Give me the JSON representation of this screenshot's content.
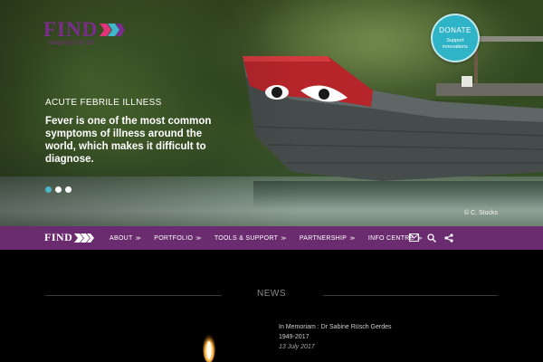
{
  "site": {
    "logo_text": "FIND",
    "logo_tagline": "diagnosis for all"
  },
  "donate": {
    "label": "DONATE",
    "sub_line1": "Support",
    "sub_line2": "innovations"
  },
  "hero": {
    "kicker": "ACUTE FEBRILE ILLNESS",
    "headline": "Fever is one of the most common symptoms of illness around the world, which makes it difficult to diagnose.",
    "slides": 3,
    "active_slide": 1,
    "credit": "© C. Stocks"
  },
  "nav": {
    "logo_text": "FIND",
    "items": [
      {
        "label": "ABOUT"
      },
      {
        "label": "PORTFOLIO"
      },
      {
        "label": "TOOLS & SUPPORT"
      },
      {
        "label": "PARTNERSHIP"
      },
      {
        "label": "INFO CENTRE"
      }
    ],
    "icons": [
      "mail-icon",
      "search-icon",
      "share-icon"
    ]
  },
  "news": {
    "heading": "NEWS",
    "item_title": "In Memoriam : Dr Sabine Rüsch Gerdes",
    "item_years": "1949-2017",
    "item_date": "13 July 2017"
  },
  "colors": {
    "brand_purple": "#6b2c6f",
    "donate_teal": "#2fb3c6",
    "dot_active": "#4bb6c8"
  }
}
